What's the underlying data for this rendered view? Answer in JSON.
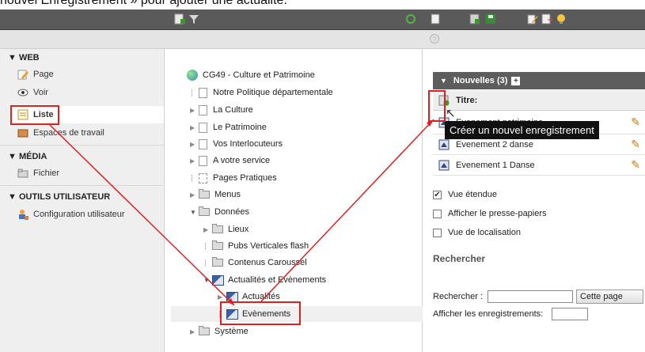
{
  "caption": {
    "text": "nouvel Enregistrement » pour ajouter une actualité."
  },
  "colors": {
    "accent_red": "#e02020",
    "toolbar_bg": "#5a5a5a",
    "header_bg": "#5d5d5d"
  },
  "toolbar": {
    "icons": [
      "new-page-icon",
      "filter-icon",
      "refresh-icon",
      "clipboard-icon",
      "new-record-icon",
      "save-icon",
      "edit-page-icon",
      "export-icon",
      "lightbulb-icon"
    ]
  },
  "sidebar": {
    "sections": [
      {
        "title": "▼ WEB",
        "items": [
          {
            "label": "Page",
            "icon": "edit-page-icon"
          },
          {
            "label": "Voir",
            "icon": "eye-icon"
          },
          {
            "label": "Liste",
            "icon": "list-icon"
          },
          {
            "label": "Espaces de travail",
            "icon": "workspace-icon"
          }
        ]
      },
      {
        "title": "▼ MÉDIA",
        "items": [
          {
            "label": "Fichier",
            "icon": "folder-icon"
          }
        ]
      },
      {
        "title": "▼ OUTILS UTILISATEUR",
        "items": [
          {
            "label": "Configuration utilisateur",
            "icon": "user-config-icon"
          }
        ]
      }
    ]
  },
  "tree": {
    "root": "CG49 - Culture et Patrimoine",
    "nodes": [
      "Notre Politique départementale",
      "La Culture",
      "Le Patrimoine",
      "Vos Interlocuteurs",
      "A votre service",
      "Pages Pratiques",
      "Menus",
      "Données",
      "Lieux",
      "Pubs Verticales flash",
      "Contenus Caroussel",
      "Actualités et Evènements",
      "Actualités",
      "Evènements",
      "Système"
    ]
  },
  "panel": {
    "header": "Nouvelles (3)",
    "column_title": "Titre:",
    "records": [
      "Evenement patrimoine",
      "Evenement 2 danse",
      "Evenement 1 Danse"
    ],
    "tooltip": "Créer un nouvel enregistrement",
    "options": [
      {
        "label": "Vue étendue",
        "checked": true
      },
      {
        "label": "Afficher le presse-papiers",
        "checked": false
      },
      {
        "label": "Vue de localisation",
        "checked": false
      }
    ],
    "search": {
      "heading": "Rechercher",
      "label": "Rechercher :",
      "value": "",
      "scope_button": "Cette page",
      "show_label": "Afficher les enregistrements:",
      "show_value": ""
    }
  }
}
